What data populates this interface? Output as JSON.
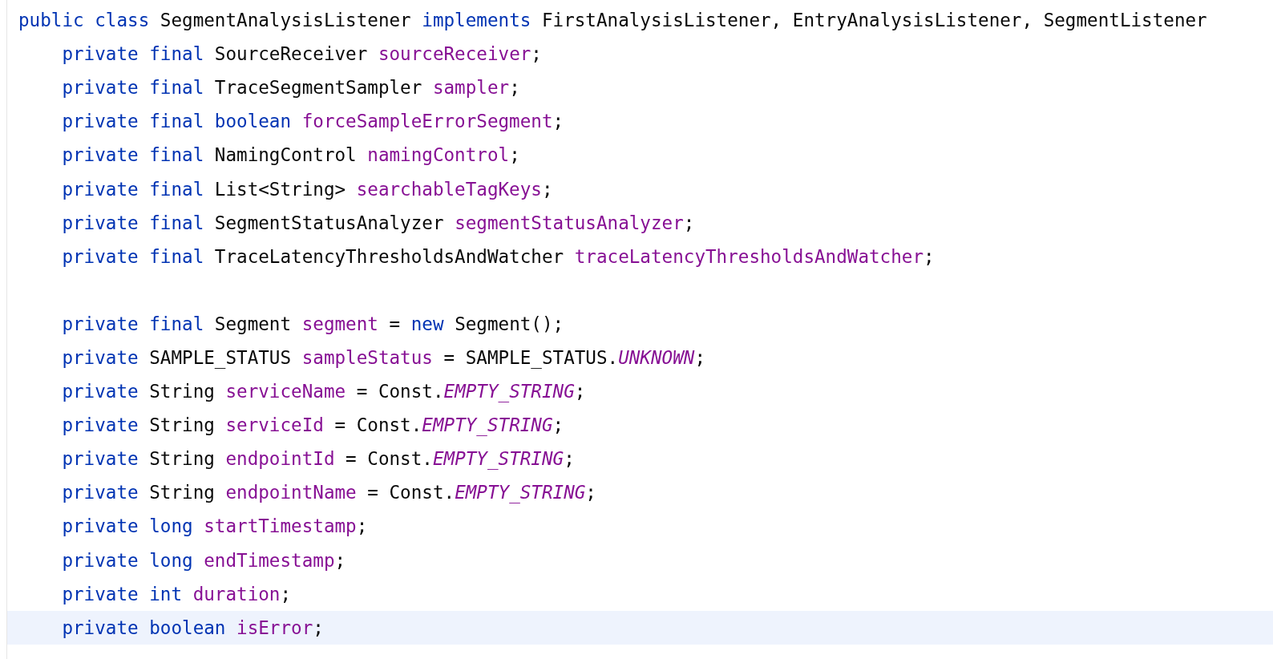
{
  "editor": {
    "declaration": {
      "current": false,
      "tokens": [
        {
          "kind": "keyword",
          "text": "public class"
        },
        {
          "kind": "plain",
          "text": " SegmentAnalysisListener "
        },
        {
          "kind": "keyword",
          "text": "implements"
        },
        {
          "kind": "plain",
          "text": " FirstAnalysisListener, EntryAnalysisListener, SegmentListener"
        }
      ]
    },
    "members": [
      {
        "current": false,
        "tokens": [
          {
            "kind": "keyword",
            "text": "private final"
          },
          {
            "kind": "plain",
            "text": " SourceReceiver "
          },
          {
            "kind": "field",
            "text": "sourceReceiver"
          },
          {
            "kind": "plain",
            "text": ";"
          }
        ]
      },
      {
        "current": false,
        "tokens": [
          {
            "kind": "keyword",
            "text": "private final"
          },
          {
            "kind": "plain",
            "text": " TraceSegmentSampler "
          },
          {
            "kind": "field",
            "text": "sampler"
          },
          {
            "kind": "plain",
            "text": ";"
          }
        ]
      },
      {
        "current": false,
        "tokens": [
          {
            "kind": "keyword",
            "text": "private final boolean "
          },
          {
            "kind": "field",
            "text": "forceSampleErrorSegment"
          },
          {
            "kind": "plain",
            "text": ";"
          }
        ]
      },
      {
        "current": false,
        "tokens": [
          {
            "kind": "keyword",
            "text": "private final"
          },
          {
            "kind": "plain",
            "text": " NamingControl "
          },
          {
            "kind": "field",
            "text": "namingControl"
          },
          {
            "kind": "plain",
            "text": ";"
          }
        ]
      },
      {
        "current": false,
        "tokens": [
          {
            "kind": "keyword",
            "text": "private final"
          },
          {
            "kind": "plain",
            "text": " List<String> "
          },
          {
            "kind": "field",
            "text": "searchableTagKeys"
          },
          {
            "kind": "plain",
            "text": ";"
          }
        ]
      },
      {
        "current": false,
        "tokens": [
          {
            "kind": "keyword",
            "text": "private final"
          },
          {
            "kind": "plain",
            "text": " SegmentStatusAnalyzer "
          },
          {
            "kind": "field",
            "text": "segmentStatusAnalyzer"
          },
          {
            "kind": "plain",
            "text": ";"
          }
        ]
      },
      {
        "current": false,
        "tokens": [
          {
            "kind": "keyword",
            "text": "private final"
          },
          {
            "kind": "plain",
            "text": " TraceLatencyThresholdsAndWatcher "
          },
          {
            "kind": "field",
            "text": "traceLatencyThresholdsAndWatcher"
          },
          {
            "kind": "plain",
            "text": ";"
          }
        ]
      },
      {
        "current": false
      },
      {
        "current": false,
        "tokens": [
          {
            "kind": "keyword",
            "text": "private final"
          },
          {
            "kind": "plain",
            "text": " Segment "
          },
          {
            "kind": "field",
            "text": "segment"
          },
          {
            "kind": "plain",
            "text": " = "
          },
          {
            "kind": "keyword",
            "text": "new"
          },
          {
            "kind": "plain",
            "text": " Segment();"
          }
        ]
      },
      {
        "current": false,
        "tokens": [
          {
            "kind": "keyword",
            "text": "private"
          },
          {
            "kind": "plain",
            "text": " SAMPLE_STATUS "
          },
          {
            "kind": "field",
            "text": "sampleStatus"
          },
          {
            "kind": "plain",
            "text": " = SAMPLE_STATUS."
          },
          {
            "kind": "constant",
            "text": "UNKNOWN"
          },
          {
            "kind": "plain",
            "text": ";"
          }
        ]
      },
      {
        "current": false,
        "tokens": [
          {
            "kind": "keyword",
            "text": "private"
          },
          {
            "kind": "plain",
            "text": " String "
          },
          {
            "kind": "field",
            "text": "serviceName"
          },
          {
            "kind": "plain",
            "text": " = Const."
          },
          {
            "kind": "constant",
            "text": "EMPTY_STRING"
          },
          {
            "kind": "plain",
            "text": ";"
          }
        ]
      },
      {
        "current": false,
        "tokens": [
          {
            "kind": "keyword",
            "text": "private"
          },
          {
            "kind": "plain",
            "text": " String "
          },
          {
            "kind": "field",
            "text": "serviceId"
          },
          {
            "kind": "plain",
            "text": " = Const."
          },
          {
            "kind": "constant",
            "text": "EMPTY_STRING"
          },
          {
            "kind": "plain",
            "text": ";"
          }
        ]
      },
      {
        "current": false,
        "tokens": [
          {
            "kind": "keyword",
            "text": "private"
          },
          {
            "kind": "plain",
            "text": " String "
          },
          {
            "kind": "field",
            "text": "endpointId"
          },
          {
            "kind": "plain",
            "text": " = Const."
          },
          {
            "kind": "constant",
            "text": "EMPTY_STRING"
          },
          {
            "kind": "plain",
            "text": ";"
          }
        ]
      },
      {
        "current": false,
        "tokens": [
          {
            "kind": "keyword",
            "text": "private"
          },
          {
            "kind": "plain",
            "text": " String "
          },
          {
            "kind": "field",
            "text": "endpointName"
          },
          {
            "kind": "plain",
            "text": " = Const."
          },
          {
            "kind": "constant",
            "text": "EMPTY_STRING"
          },
          {
            "kind": "plain",
            "text": ";"
          }
        ]
      },
      {
        "current": false,
        "tokens": [
          {
            "kind": "keyword",
            "text": "private long "
          },
          {
            "kind": "field",
            "text": "startTimestamp"
          },
          {
            "kind": "plain",
            "text": ";"
          }
        ]
      },
      {
        "current": false,
        "tokens": [
          {
            "kind": "keyword",
            "text": "private long "
          },
          {
            "kind": "field",
            "text": "endTimestamp"
          },
          {
            "kind": "plain",
            "text": ";"
          }
        ]
      },
      {
        "current": false,
        "tokens": [
          {
            "kind": "keyword",
            "text": "private int "
          },
          {
            "kind": "field",
            "text": "duration"
          },
          {
            "kind": "plain",
            "text": ";"
          }
        ]
      },
      {
        "current": true,
        "tokens": [
          {
            "kind": "keyword",
            "text": "private boolean "
          },
          {
            "kind": "field",
            "text": "isError"
          },
          {
            "kind": "plain",
            "text": ";"
          }
        ]
      }
    ]
  }
}
